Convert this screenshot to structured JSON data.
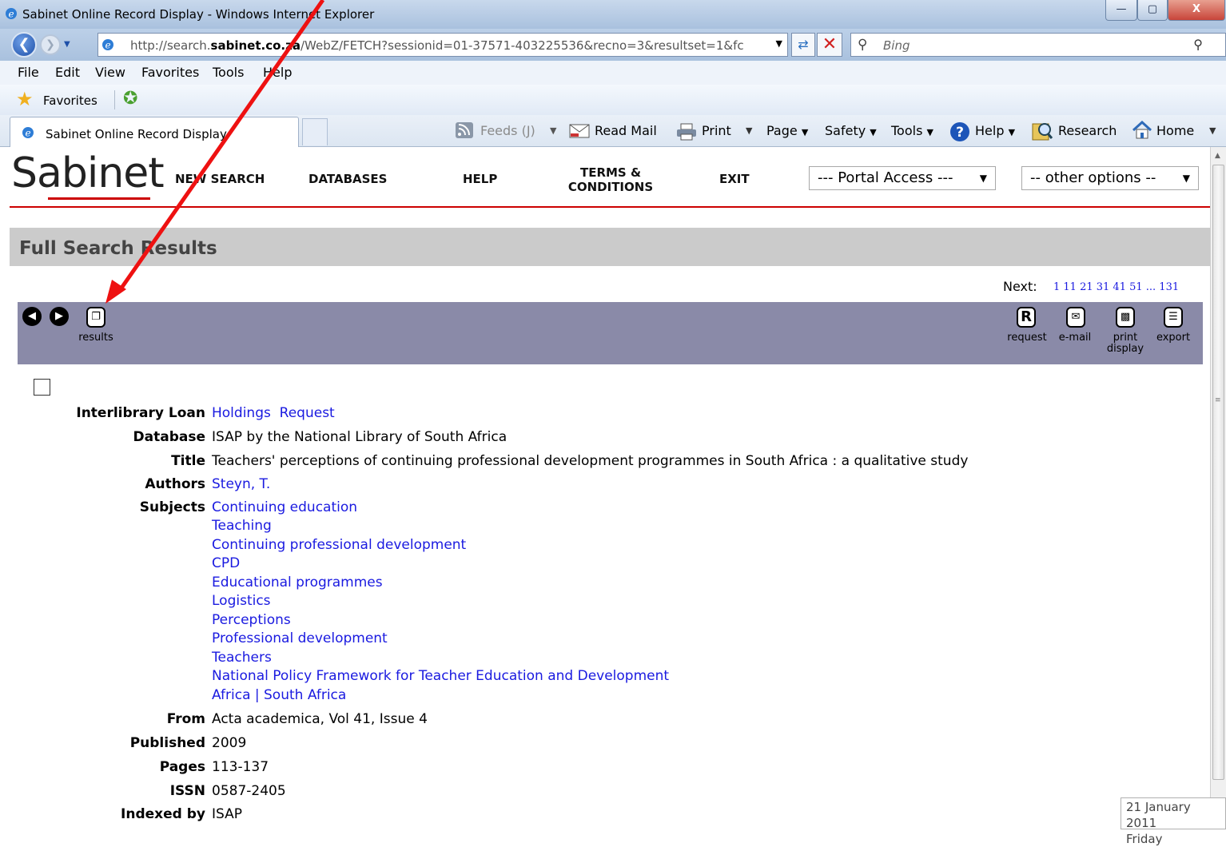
{
  "window": {
    "title": "Sabinet Online Record Display - Windows Internet Explorer",
    "min": "—",
    "max": "▢",
    "close": "X"
  },
  "address": {
    "url_prefix": "http://search.",
    "url_domain": "sabinet.co.za",
    "url_rest": "/WebZ/FETCH?sessionid=01-37571-403225536&recno=3&resultset=1&fc",
    "search_placeholder": "Bing"
  },
  "menu": [
    "File",
    "Edit",
    "View",
    "Favorites",
    "Tools",
    "Help"
  ],
  "favorites": {
    "label": "Favorites"
  },
  "tab": {
    "label": "Sabinet Online Record Display"
  },
  "commands": {
    "feeds": "Feeds (J)",
    "read_mail": "Read Mail",
    "print": "Print",
    "page": "Page",
    "safety": "Safety",
    "tools": "Tools",
    "help": "Help",
    "research": "Research",
    "home": "Home"
  },
  "site": {
    "logo": "Sabinet",
    "nav": {
      "new_search": "NEW SEARCH",
      "databases": "DATABASES",
      "help": "HELP",
      "terms_1": "TERMS &",
      "terms_2": "CONDITIONS",
      "exit": "EXIT"
    },
    "portal_select": "--- Portal Access ---",
    "options_select": "-- other options --",
    "results_title": "Full Search Results",
    "next_label": "Next:",
    "next_pages": "1 11 21 31 41 51 ... 131"
  },
  "toolbar": {
    "results": "results",
    "request": "request",
    "email": "e-mail",
    "print_1": "print",
    "print_2": "display",
    "export": "export"
  },
  "record": {
    "labels": {
      "ill": "Interlibrary Loan",
      "database": "Database",
      "title": "Title",
      "authors": "Authors",
      "subjects": "Subjects",
      "from": "From",
      "published": "Published",
      "pages": "Pages",
      "issn": "ISSN",
      "indexed_by": "Indexed by"
    },
    "ill_holdings": "Holdings",
    "ill_request": "Request",
    "database": "ISAP by the National Library of South Africa",
    "title": "Teachers' perceptions of continuing professional development programmes in South Africa : a qualitative study",
    "authors": "Steyn, T.",
    "subjects": [
      "Continuing education",
      "Teaching",
      "Continuing professional development",
      "CPD",
      "Educational programmes",
      "Logistics",
      "Perceptions",
      "Professional development",
      "Teachers",
      "National Policy Framework for Teacher Education and Development",
      "Africa | South Africa"
    ],
    "from": "Acta academica, Vol 41, Issue 4",
    "published": "2009",
    "pages": "113-137",
    "issn": "0587-2405",
    "indexed_by": "ISAP"
  },
  "datebox": {
    "date": "21 January 2011",
    "day": "Friday"
  },
  "colors": {
    "brand_red": "#cc0000",
    "link_blue": "#1a1ae0",
    "toolbar": "#8a8aa8",
    "annotation_arrow": "#ee1111"
  }
}
